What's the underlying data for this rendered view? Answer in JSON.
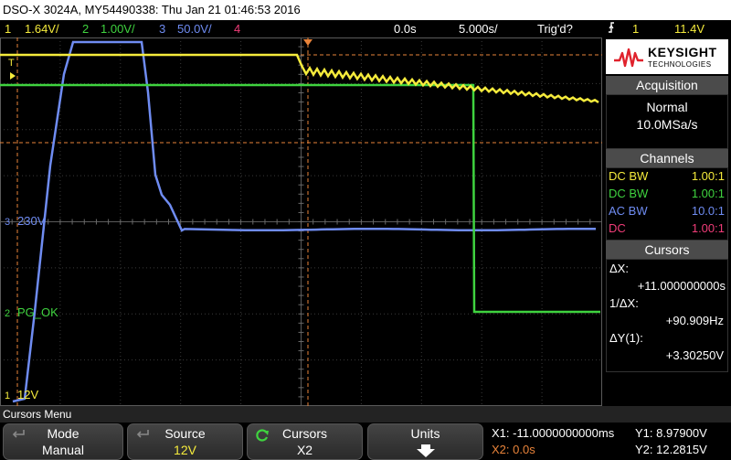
{
  "title_bar": {
    "text": "DSO-X 3024A, MY54490338: Thu Jan 21 01:46:53 2016"
  },
  "status_bar": {
    "ch1_num": "1",
    "ch1_scale": "1.64V/",
    "ch2_num": "2",
    "ch2_scale": "1.00V/",
    "ch3_num": "3",
    "ch3_scale": "50.0V/",
    "ch4_num": "4",
    "time_offset": "0.0s",
    "time_scale": "5.000s/",
    "trigger_status": "Trig'd?",
    "trigger_channel": "1",
    "trigger_level": "11.4V"
  },
  "waveform_labels": {
    "ch3": "230V",
    "ch2": "PG_OK",
    "ch1": "12V",
    "trigger_marker": "T"
  },
  "colors": {
    "ch1": "#f5eb3c",
    "ch2": "#3fd33f",
    "ch3": "#6f8cf2",
    "ch4": "#f03c78",
    "cursor": "#e8833a"
  },
  "brand": {
    "name": "KEYSIGHT",
    "sub": "TECHNOLOGIES",
    "logo_icon": "keysight-wave-icon"
  },
  "acquisition": {
    "heading": "Acquisition",
    "mode": "Normal",
    "rate": "10.0MSa/s"
  },
  "channels": {
    "heading": "Channels",
    "rows": [
      {
        "coupling": "DC BW",
        "probe": "1.00:1"
      },
      {
        "coupling": "DC BW",
        "probe": "1.00:1"
      },
      {
        "coupling": "AC BW",
        "probe": "10.0:1"
      },
      {
        "coupling": "DC",
        "probe": "1.00:1"
      }
    ]
  },
  "cursors": {
    "heading": "Cursors",
    "dx_label": "ΔX:",
    "dx_value": "+11.000000000s",
    "inv_dx_label": "1/ΔX:",
    "inv_dx_value": "+90.909Hz",
    "dy_label": "ΔY(1):",
    "dy_value": "+3.30250V"
  },
  "menu": {
    "title": "Cursors Menu",
    "softkeys": [
      {
        "top": "Mode",
        "bottom": "Manual"
      },
      {
        "top": "Source",
        "bottom": "12V"
      },
      {
        "top": "Cursors",
        "bottom": "X2"
      },
      {
        "top": "Units",
        "bottom": ""
      }
    ],
    "softkey_icons": [
      "return-icon",
      "return-icon",
      "rotate-knob-icon",
      "down-arrow-icon"
    ]
  },
  "readout": {
    "x1": "X1: -11.0000000000ms",
    "x2": "X2: 0.0s",
    "y1": "Y1: 8.97900V",
    "y2": "Y2: 12.2815V"
  }
}
